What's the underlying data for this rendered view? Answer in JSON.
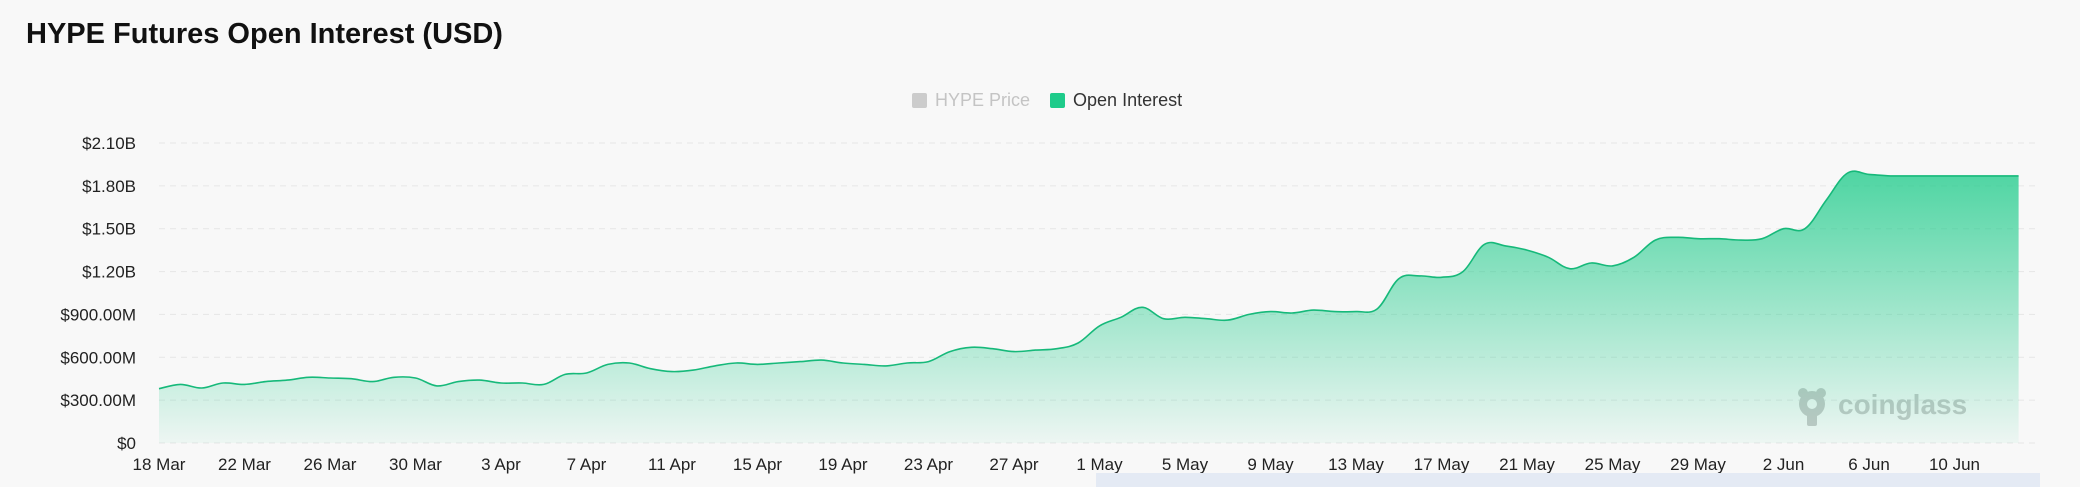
{
  "title": "HYPE Futures Open Interest (USD)",
  "legend": {
    "items": [
      {
        "label": "HYPE Price",
        "active": false,
        "color": "#cccccc"
      },
      {
        "label": "Open Interest",
        "active": true,
        "color": "#1ecb8a"
      }
    ]
  },
  "watermark": {
    "text": "coinglass",
    "icon": "coinglass-logo-icon"
  },
  "colors": {
    "series": "#1ecb8a",
    "line": "#16b97a",
    "grid": "#e6e6e6"
  },
  "chart_data": {
    "type": "area",
    "title": "HYPE Futures Open Interest (USD)",
    "xlabel": "",
    "ylabel": "",
    "y_tick_labels": [
      "$0",
      "$300.00M",
      "$600.00M",
      "$900.00M",
      "$1.20B",
      "$1.50B",
      "$1.80B",
      "$2.10B"
    ],
    "y_ticks": [
      0,
      300,
      600,
      900,
      1200,
      1500,
      1800,
      2100
    ],
    "ylim": [
      0,
      2100
    ],
    "y_unit": "USD millions",
    "x_tick_labels": [
      "18 Mar",
      "22 Mar",
      "26 Mar",
      "30 Mar",
      "3 Apr",
      "7 Apr",
      "11 Apr",
      "15 Apr",
      "19 Apr",
      "23 Apr",
      "27 Apr",
      "1 May",
      "5 May",
      "9 May",
      "13 May",
      "17 May",
      "21 May",
      "25 May",
      "29 May",
      "2 Jun",
      "6 Jun",
      "10 Jun"
    ],
    "grid": "horizontal dashed",
    "legend_position": "top-center",
    "series": [
      {
        "name": "Open Interest",
        "x": [
          "18 Mar",
          "19 Mar",
          "20 Mar",
          "21 Mar",
          "22 Mar",
          "23 Mar",
          "24 Mar",
          "25 Mar",
          "26 Mar",
          "27 Mar",
          "28 Mar",
          "29 Mar",
          "30 Mar",
          "31 Mar",
          "1 Apr",
          "2 Apr",
          "3 Apr",
          "4 Apr",
          "5 Apr",
          "6 Apr",
          "7 Apr",
          "8 Apr",
          "9 Apr",
          "10 Apr",
          "11 Apr",
          "12 Apr",
          "13 Apr",
          "14 Apr",
          "15 Apr",
          "16 Apr",
          "17 Apr",
          "18 Apr",
          "19 Apr",
          "20 Apr",
          "21 Apr",
          "22 Apr",
          "23 Apr",
          "24 Apr",
          "25 Apr",
          "26 Apr",
          "27 Apr",
          "28 Apr",
          "29 Apr",
          "30 Apr",
          "1 May",
          "2 May",
          "3 May",
          "4 May",
          "5 May",
          "6 May",
          "7 May",
          "8 May",
          "9 May",
          "10 May",
          "11 May",
          "12 May",
          "13 May",
          "14 May",
          "15 May",
          "16 May",
          "17 May",
          "18 May",
          "19 May",
          "20 May",
          "21 May",
          "22 May",
          "23 May",
          "24 May",
          "25 May",
          "26 May",
          "27 May",
          "28 May",
          "29 May",
          "30 May",
          "31 May",
          "1 Jun",
          "2 Jun",
          "3 Jun",
          "4 Jun",
          "5 Jun",
          "6 Jun",
          "7 Jun",
          "8 Jun",
          "9 Jun",
          "10 Jun",
          "11 Jun",
          "12 Jun",
          "13 Jun"
        ],
        "values": [
          380,
          410,
          385,
          420,
          410,
          430,
          440,
          460,
          455,
          450,
          430,
          460,
          455,
          400,
          430,
          440,
          420,
          420,
          410,
          480,
          490,
          550,
          560,
          520,
          500,
          510,
          540,
          560,
          550,
          560,
          570,
          580,
          560,
          550,
          540,
          560,
          570,
          640,
          670,
          660,
          640,
          650,
          660,
          700,
          820,
          880,
          950,
          870,
          880,
          870,
          860,
          900,
          920,
          910,
          930,
          920,
          920,
          940,
          1150,
          1170,
          1160,
          1200,
          1390,
          1380,
          1350,
          1300,
          1220,
          1260,
          1240,
          1300,
          1420,
          1440,
          1430,
          1430,
          1420,
          1430,
          1500,
          1500,
          1700,
          1890,
          1880,
          1870,
          1870,
          1870,
          1870,
          1870,
          1870,
          1870
        ]
      }
    ]
  }
}
